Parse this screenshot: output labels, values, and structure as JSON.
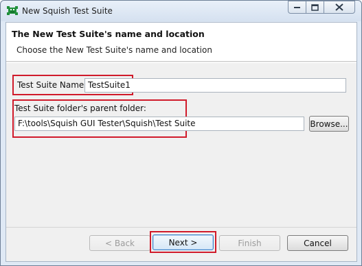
{
  "window": {
    "title": "New Squish Test Suite",
    "minimize_icon": "minimize-icon",
    "maximize_icon": "maximize-icon",
    "close_icon": "close-icon",
    "app_icon": "squish-app-icon"
  },
  "header": {
    "title": "The New Test Suite's name and location",
    "subtitle": "Choose the New Test Suite's name and location"
  },
  "form": {
    "name_label": "Test Suite Name:",
    "name_value": "TestSuite1",
    "folder_label": "Test Suite folder's parent folder:",
    "folder_value": "F:\\tools\\Squish GUI Tester\\Squish\\Test Suite",
    "browse_label": "Browse..."
  },
  "buttons": {
    "back": "< Back",
    "next": "Next >",
    "finish": "Finish",
    "cancel": "Cancel"
  },
  "colors": {
    "highlight": "#d01a2a",
    "title_bg": "#dfe9f5",
    "default_button_border": "#3b7fc4"
  }
}
